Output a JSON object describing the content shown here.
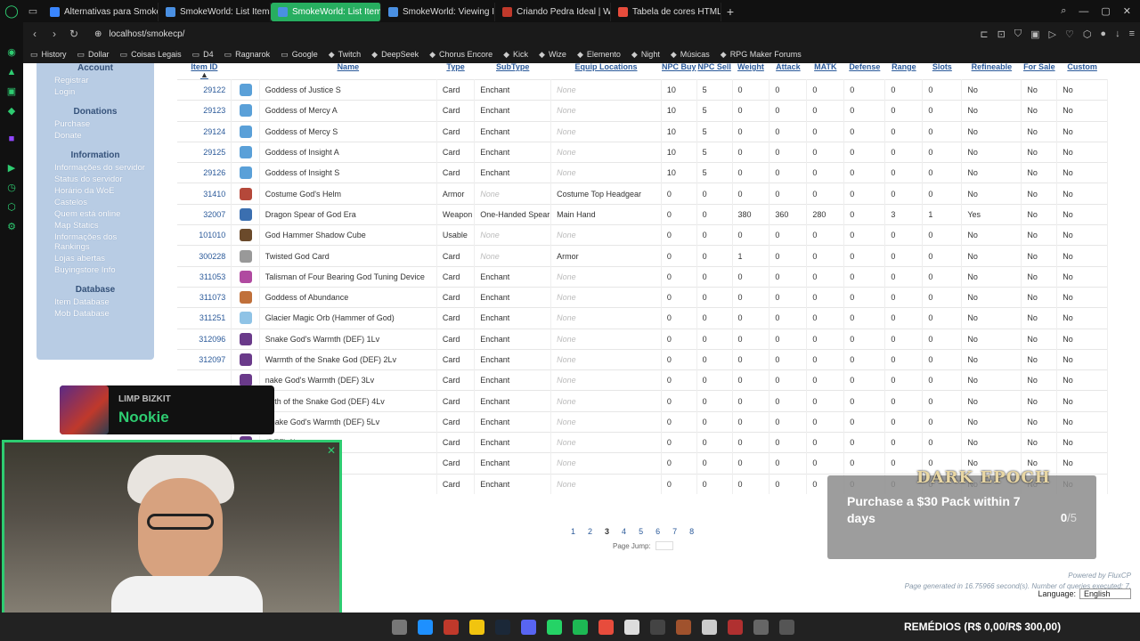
{
  "tabs": [
    {
      "label": "Alternativas para Smoke C",
      "active": false,
      "fav": "#3a86ff"
    },
    {
      "label": "SmokeWorld: List Items",
      "active": false,
      "fav": "#4a90e2"
    },
    {
      "label": "SmokeWorld: List Items",
      "active": true,
      "fav": "#4a90e2"
    },
    {
      "label": "SmokeWorld: Viewing Iten",
      "active": false,
      "fav": "#4a90e2"
    },
    {
      "label": "Criando Pedra Ideal | WYD",
      "active": false,
      "fav": "#c0392b"
    },
    {
      "label": "Tabela de cores HTML: ap",
      "active": false,
      "fav": "#e74c3c"
    }
  ],
  "address": {
    "url": "localhost/smokecp/"
  },
  "bookmarks": [
    "History",
    "Dollar",
    "Coisas Legais",
    "D4",
    "Ragnarok",
    "Google",
    "Twitch",
    "DeepSeek",
    "Chorus Encore",
    "Kick",
    "Wize",
    "Elemento",
    "Night",
    "Músicas",
    "RPG Maker Forums"
  ],
  "sidebar": {
    "sections": [
      {
        "title": "Account",
        "links": [
          "Registrar",
          "Login"
        ]
      },
      {
        "title": "Donations",
        "links": [
          "Purchase",
          "Donate"
        ]
      },
      {
        "title": "Information",
        "links": [
          "Informações do servidor",
          "Status do servidor",
          "Horário da WoE",
          "Castelos",
          "Quem está online",
          "Map Statics",
          "Informações dos Rankings",
          "Lojas abertas",
          "Buyingstore Info"
        ]
      },
      {
        "title": "Database",
        "links": [
          "Item Database",
          "Mob Database"
        ]
      }
    ]
  },
  "table": {
    "headers": [
      "Item ID",
      "Name",
      "Type",
      "SubType",
      "Equip Locations",
      "NPC Buy",
      "NPC Sell",
      "Weight",
      "Attack",
      "MATK",
      "Defense",
      "Range",
      "Slots",
      "Refineable",
      "For Sale",
      "Custom"
    ],
    "sort_indicator": "▲",
    "rows": [
      {
        "id": "29122",
        "name": "Goddess of Justice S",
        "type": "Card",
        "subtype": "Enchant",
        "equip": "None",
        "buy": "10",
        "sell": "5",
        "weight": "0",
        "atk": "0",
        "matk": "0",
        "def": "0",
        "range": "0",
        "slots": "0",
        "refine": "No",
        "sale": "No",
        "custom": "No",
        "icon": "#5aa0d8"
      },
      {
        "id": "29123",
        "name": "Goddess of Mercy A",
        "type": "Card",
        "subtype": "Enchant",
        "equip": "None",
        "buy": "10",
        "sell": "5",
        "weight": "0",
        "atk": "0",
        "matk": "0",
        "def": "0",
        "range": "0",
        "slots": "0",
        "refine": "No",
        "sale": "No",
        "custom": "No",
        "icon": "#5aa0d8"
      },
      {
        "id": "29124",
        "name": "Goddess of Mercy S",
        "type": "Card",
        "subtype": "Enchant",
        "equip": "None",
        "buy": "10",
        "sell": "5",
        "weight": "0",
        "atk": "0",
        "matk": "0",
        "def": "0",
        "range": "0",
        "slots": "0",
        "refine": "No",
        "sale": "No",
        "custom": "No",
        "icon": "#5aa0d8"
      },
      {
        "id": "29125",
        "name": "Goddess of Insight A",
        "type": "Card",
        "subtype": "Enchant",
        "equip": "None",
        "buy": "10",
        "sell": "5",
        "weight": "0",
        "atk": "0",
        "matk": "0",
        "def": "0",
        "range": "0",
        "slots": "0",
        "refine": "No",
        "sale": "No",
        "custom": "No",
        "icon": "#5aa0d8"
      },
      {
        "id": "29126",
        "name": "Goddess of Insight S",
        "type": "Card",
        "subtype": "Enchant",
        "equip": "None",
        "buy": "10",
        "sell": "5",
        "weight": "0",
        "atk": "0",
        "matk": "0",
        "def": "0",
        "range": "0",
        "slots": "0",
        "refine": "No",
        "sale": "No",
        "custom": "No",
        "icon": "#5aa0d8"
      },
      {
        "id": "31410",
        "name": "Costume God's Helm",
        "type": "Armor",
        "subtype": "None",
        "equip": "Costume Top Headgear",
        "buy": "0",
        "sell": "0",
        "weight": "0",
        "atk": "0",
        "matk": "0",
        "def": "0",
        "range": "0",
        "slots": "0",
        "refine": "No",
        "sale": "No",
        "custom": "No",
        "icon": "#b5483a"
      },
      {
        "id": "32007",
        "name": "Dragon Spear of God Era",
        "type": "Weapon",
        "subtype": "One-Handed Spear",
        "equip": "Main Hand",
        "buy": "0",
        "sell": "0",
        "weight": "380",
        "atk": "360",
        "matk": "280",
        "def": "0",
        "range": "3",
        "slots": "1",
        "refine": "Yes",
        "sale": "No",
        "custom": "No",
        "icon": "#3b6fb0"
      },
      {
        "id": "101010",
        "name": "God Hammer Shadow Cube",
        "type": "Usable",
        "subtype": "None",
        "equip": "None",
        "buy": "0",
        "sell": "0",
        "weight": "0",
        "atk": "0",
        "matk": "0",
        "def": "0",
        "range": "0",
        "slots": "0",
        "refine": "No",
        "sale": "No",
        "custom": "No",
        "icon": "#6b4a2b"
      },
      {
        "id": "300228",
        "name": "Twisted God Card",
        "type": "Card",
        "subtype": "None",
        "equip": "Armor",
        "buy": "0",
        "sell": "0",
        "weight": "1",
        "atk": "0",
        "matk": "0",
        "def": "0",
        "range": "0",
        "slots": "0",
        "refine": "No",
        "sale": "No",
        "custom": "No",
        "icon": "#999999"
      },
      {
        "id": "311053",
        "name": "Talisman of Four Bearing God Tuning Device",
        "type": "Card",
        "subtype": "Enchant",
        "equip": "None",
        "buy": "0",
        "sell": "0",
        "weight": "0",
        "atk": "0",
        "matk": "0",
        "def": "0",
        "range": "0",
        "slots": "0",
        "refine": "No",
        "sale": "No",
        "custom": "No",
        "icon": "#b04aa0"
      },
      {
        "id": "311073",
        "name": "Goddess of Abundance",
        "type": "Card",
        "subtype": "Enchant",
        "equip": "None",
        "buy": "0",
        "sell": "0",
        "weight": "0",
        "atk": "0",
        "matk": "0",
        "def": "0",
        "range": "0",
        "slots": "0",
        "refine": "No",
        "sale": "No",
        "custom": "No",
        "icon": "#c0703a"
      },
      {
        "id": "311251",
        "name": "Glacier Magic Orb (Hammer of God)",
        "type": "Card",
        "subtype": "Enchant",
        "equip": "None",
        "buy": "0",
        "sell": "0",
        "weight": "0",
        "atk": "0",
        "matk": "0",
        "def": "0",
        "range": "0",
        "slots": "0",
        "refine": "No",
        "sale": "No",
        "custom": "No",
        "icon": "#8fc3e6"
      },
      {
        "id": "312096",
        "name": "Snake God's Warmth (DEF) 1Lv",
        "type": "Card",
        "subtype": "Enchant",
        "equip": "None",
        "buy": "0",
        "sell": "0",
        "weight": "0",
        "atk": "0",
        "matk": "0",
        "def": "0",
        "range": "0",
        "slots": "0",
        "refine": "No",
        "sale": "No",
        "custom": "No",
        "icon": "#6a3a8a"
      },
      {
        "id": "312097",
        "name": "Warmth of the Snake God (DEF) 2Lv",
        "type": "Card",
        "subtype": "Enchant",
        "equip": "None",
        "buy": "0",
        "sell": "0",
        "weight": "0",
        "atk": "0",
        "matk": "0",
        "def": "0",
        "range": "0",
        "slots": "0",
        "refine": "No",
        "sale": "No",
        "custom": "No",
        "icon": "#6a3a8a"
      },
      {
        "id": "",
        "name": "nake God's Warmth (DEF) 3Lv",
        "type": "Card",
        "subtype": "Enchant",
        "equip": "None",
        "buy": "0",
        "sell": "0",
        "weight": "0",
        "atk": "0",
        "matk": "0",
        "def": "0",
        "range": "0",
        "slots": "0",
        "refine": "No",
        "sale": "No",
        "custom": "No",
        "icon": "#6a3a8a"
      },
      {
        "id": "",
        "name": "rmth of the Snake God (DEF) 4Lv",
        "type": "Card",
        "subtype": "Enchant",
        "equip": "None",
        "buy": "0",
        "sell": "0",
        "weight": "0",
        "atk": "0",
        "matk": "0",
        "def": "0",
        "range": "0",
        "slots": "0",
        "refine": "No",
        "sale": "No",
        "custom": "No",
        "icon": "#6a3a8a"
      },
      {
        "id": "312100",
        "name": "Snake God's Warmth (DEF) 5Lv",
        "type": "Card",
        "subtype": "Enchant",
        "equip": "None",
        "buy": "0",
        "sell": "0",
        "weight": "0",
        "atk": "0",
        "matk": "0",
        "def": "0",
        "range": "0",
        "slots": "0",
        "refine": "No",
        "sale": "No",
        "custom": "No",
        "icon": "#6a3a8a"
      },
      {
        "id": "",
        "name": "(DEF) 6Lv",
        "type": "Card",
        "subtype": "Enchant",
        "equip": "None",
        "buy": "0",
        "sell": "0",
        "weight": "0",
        "atk": "0",
        "matk": "0",
        "def": "0",
        "range": "0",
        "slots": "0",
        "refine": "No",
        "sale": "No",
        "custom": "No",
        "icon": "#6a3a8a"
      },
      {
        "id": "",
        "name": "God (DEF) 7Lv",
        "type": "Card",
        "subtype": "Enchant",
        "equip": "None",
        "buy": "0",
        "sell": "0",
        "weight": "0",
        "atk": "0",
        "matk": "0",
        "def": "0",
        "range": "0",
        "slots": "0",
        "refine": "No",
        "sale": "No",
        "custom": "No",
        "icon": "#6a3a8a"
      },
      {
        "id": "",
        "name": "God (DEF) 8Lv",
        "type": "Card",
        "subtype": "Enchant",
        "equip": "None",
        "buy": "0",
        "sell": "0",
        "weight": "0",
        "atk": "0",
        "matk": "0",
        "def": "0",
        "range": "0",
        "slots": "0",
        "refine": "No",
        "sale": "No",
        "custom": "No",
        "icon": "#6a3a8a"
      }
    ]
  },
  "pagination": {
    "pages": [
      "1",
      "2",
      "3",
      "4",
      "5",
      "6",
      "7",
      "8"
    ],
    "current": "3",
    "jump_label": "Page Jump:"
  },
  "footer": {
    "powered": "Powered by FluxCP",
    "generated": "Page generated in 16.75966 second(s). Number of queries executed: 7.",
    "language_label": "Language:",
    "language_value": "English"
  },
  "now_playing": {
    "artist": "LIMP BIZKIT",
    "song": "Nookie"
  },
  "promo": {
    "logo": "DARK EPOCH",
    "title": "Purchase a $30 Pack within 7 days",
    "progress": "0",
    "total": "/5"
  },
  "taskbar": {
    "note": "REMÉDIOS (R$ 0,00/R$ 300,00)"
  }
}
